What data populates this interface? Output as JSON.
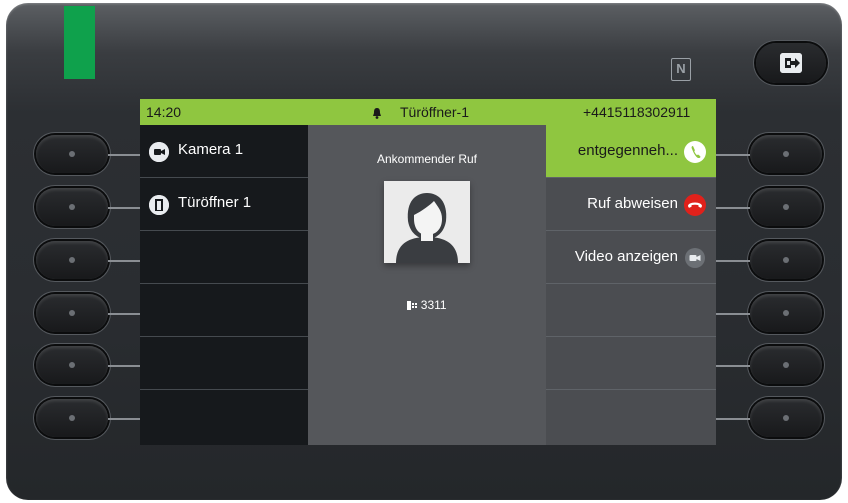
{
  "status_bar": {
    "time": "14:20",
    "caller": "Türöffner-1",
    "number": "+4415118302911",
    "icon": "bell-icon"
  },
  "left_menu": {
    "items": [
      {
        "label": "Kamera 1",
        "icon": "video-camera-icon"
      },
      {
        "label": "Türöffner 1",
        "icon": "door-icon"
      },
      {
        "label": ""
      },
      {
        "label": ""
      },
      {
        "label": ""
      },
      {
        "label": ""
      }
    ]
  },
  "call": {
    "title": "Ankommender Ruf",
    "avatar": "person-avatar-icon",
    "extension": "3311",
    "extension_icon": "phone-extension-icon"
  },
  "right_menu": {
    "items": [
      {
        "label": "entgegenneh...",
        "icon": "phone-answer-icon",
        "active": true
      },
      {
        "label": "Ruf abweisen",
        "icon": "phone-hangup-icon"
      },
      {
        "label": "Video anzeigen",
        "icon": "video-camera-icon"
      },
      {
        "label": ""
      },
      {
        "label": ""
      },
      {
        "label": ""
      }
    ]
  },
  "colors": {
    "accent": "#8fc640",
    "led": "#0fa14c",
    "reject": "#e0211b",
    "screen_left_bg": "#16191c"
  },
  "hardware": {
    "nfc_label": "N",
    "exit_icon": "exit-icon"
  }
}
